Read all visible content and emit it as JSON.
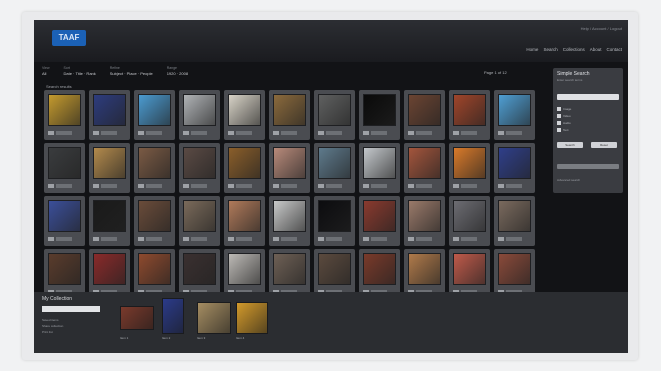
{
  "app": {
    "logo": "TAAF"
  },
  "header": {
    "utility": "Help / Account / Logout",
    "nav": [
      "Home",
      "Search",
      "Collections",
      "About",
      "Contact"
    ]
  },
  "filters": [
    {
      "label": "View",
      "values": "All"
    },
    {
      "label": "Sort",
      "values": "Date · Title · Rank"
    },
    {
      "label": "Refine",
      "values": "Subject · Place · People"
    },
    {
      "label": "Range",
      "values": "1920 · 2008"
    }
  ],
  "paging": "Page 1 of 12",
  "results_text": "Search results",
  "sidebar": {
    "title": "Simple Search",
    "subtitle": "Enter search terms",
    "options": [
      "Image",
      "Video",
      "Audio",
      "Text"
    ],
    "buttons": [
      "Search",
      "Reset"
    ],
    "footer": "Advanced search"
  },
  "collection": {
    "title": "My Collection",
    "lines": [
      "Saved items",
      "Share collection",
      "Print list"
    ],
    "items": [
      {
        "caption": "Item 1",
        "color": "#7a3a2c"
      },
      {
        "caption": "Item 2",
        "color": "#2b3b8a"
      },
      {
        "caption": "Item 3",
        "color": "#a58d62"
      },
      {
        "caption": "Item 4",
        "color": "#d39a2b"
      }
    ]
  },
  "tiles": [
    {
      "color": "#c49a2e"
    },
    {
      "color": "#2d3c7e"
    },
    {
      "color": "#4b9bd1"
    },
    {
      "color": "#b0b3b6"
    },
    {
      "color": "#d8d3c7"
    },
    {
      "color": "#8b6a3c"
    },
    {
      "color": "#5f6060"
    },
    {
      "color": "#0a0a0a"
    },
    {
      "color": "#6b4432"
    },
    {
      "color": "#a0452a"
    },
    {
      "color": "#4f9fd4"
    },
    {
      "color": "#3a3c3e"
    },
    {
      "color": "#b38a4c"
    },
    {
      "color": "#7a5a44"
    },
    {
      "color": "#5a4a44"
    },
    {
      "color": "#8a5e2a"
    },
    {
      "color": "#b88a7a"
    },
    {
      "color": "#5e7a8c"
    },
    {
      "color": "#c4c8cc"
    },
    {
      "color": "#a3553c"
    },
    {
      "color": "#d97a2a"
    },
    {
      "color": "#2f3f8a"
    },
    {
      "color": "#3b4f9a"
    },
    {
      "color": "#1a1a1a"
    },
    {
      "color": "#6a4c3a"
    },
    {
      "color": "#7a6a5a"
    },
    {
      "color": "#b07a5a"
    },
    {
      "color": "#c8c9c9"
    },
    {
      "color": "#0c0c0f"
    },
    {
      "color": "#8a3a2e"
    },
    {
      "color": "#9a7a6a"
    },
    {
      "color": "#6c6c72"
    },
    {
      "color": "#7a6a5e"
    },
    {
      "color": "#5a3c2c"
    },
    {
      "color": "#8a2a2a"
    },
    {
      "color": "#8e4a2e"
    },
    {
      "color": "#3a3030"
    },
    {
      "color": "#bdbab6"
    },
    {
      "color": "#6e6055"
    },
    {
      "color": "#5b4a3e"
    },
    {
      "color": "#7a3a2a"
    },
    {
      "color": "#b07a4a"
    },
    {
      "color": "#c05a4a"
    },
    {
      "color": "#8a4a3a"
    }
  ]
}
